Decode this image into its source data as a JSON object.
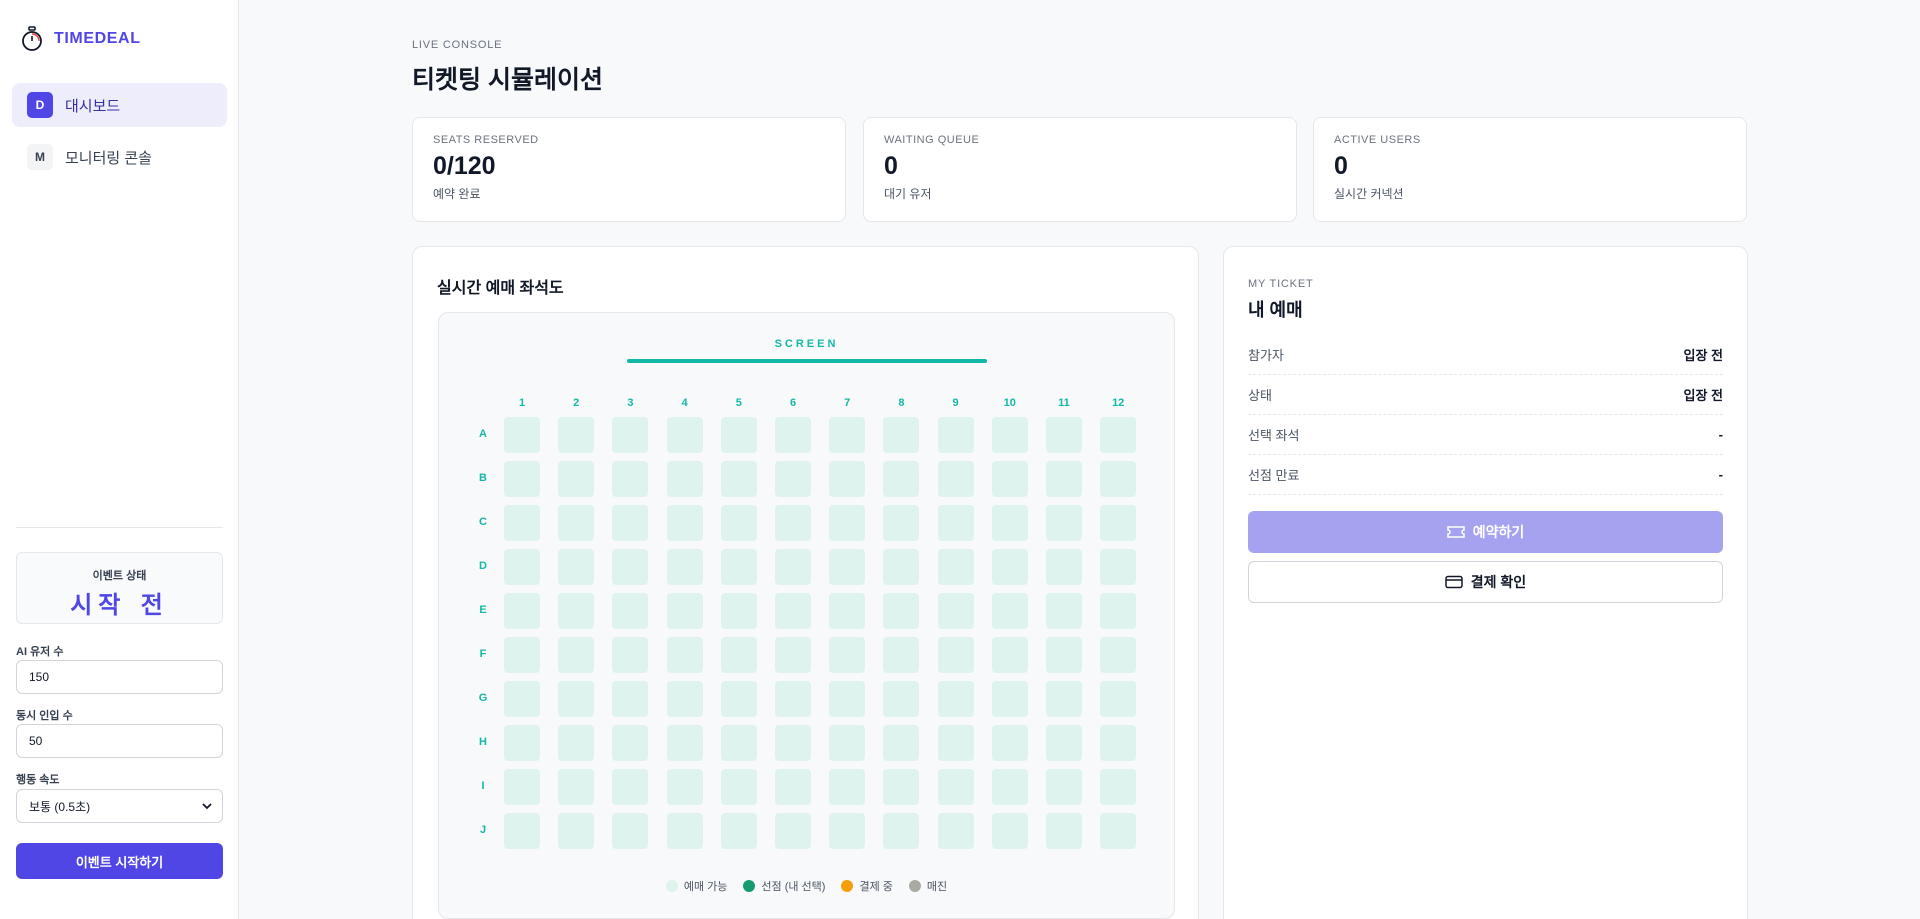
{
  "brand": {
    "name": "TIMEDEAL"
  },
  "nav": {
    "items": [
      {
        "badge": "D",
        "label": "대시보드"
      },
      {
        "badge": "M",
        "label": "모니터링 콘솔"
      }
    ]
  },
  "event": {
    "status_label": "이벤트 상태",
    "status_value": "시작 전"
  },
  "controls": {
    "ai_users_label": "AI 유저 수",
    "ai_users_value": "150",
    "concurrent_label": "동시 인입 수",
    "concurrent_value": "50",
    "speed_label": "행동 속도",
    "speed_value": "보통 (0.5초)",
    "start_button": "이벤트 시작하기"
  },
  "header": {
    "eyebrow": "LIVE CONSOLE",
    "title": "티켓팅 시뮬레이션"
  },
  "stats": [
    {
      "label": "SEATS RESERVED",
      "value": "0/120",
      "sub": "예약 완료"
    },
    {
      "label": "WAITING QUEUE",
      "value": "0",
      "sub": "대기 유저"
    },
    {
      "label": "ACTIVE USERS",
      "value": "0",
      "sub": "실시간 커넥션"
    }
  ],
  "seatmap": {
    "title": "실시간 예매 좌석도",
    "screen_label": "SCREEN",
    "columns": [
      "1",
      "2",
      "3",
      "4",
      "5",
      "6",
      "7",
      "8",
      "9",
      "10",
      "11",
      "12"
    ],
    "rows": [
      "A",
      "B",
      "C",
      "D",
      "E",
      "F",
      "G",
      "H",
      "I",
      "J"
    ],
    "seat_state": "available",
    "legend": [
      {
        "label": "예매 가능",
        "color": "#dff3ee"
      },
      {
        "label": "선점 (내 선택)",
        "color": "#149b72"
      },
      {
        "label": "결제 중",
        "color": "#f59e0b"
      },
      {
        "label": "매진",
        "color": "#a8aaa3"
      }
    ],
    "colors": {
      "accent": "#14b8a6",
      "seat_available": "#dff3ee"
    }
  },
  "ticket": {
    "eyebrow": "MY TICKET",
    "title": "내 예매",
    "rows": [
      {
        "key": "참가자",
        "value": "입장 전"
      },
      {
        "key": "상태",
        "value": "입장 전"
      },
      {
        "key": "선택 좌석",
        "value": "-"
      },
      {
        "key": "선점 만료",
        "value": "-"
      }
    ],
    "reserve_button": "예약하기",
    "pay_button": "결제 확인"
  },
  "colors": {
    "primary": "#4f46e5",
    "primary_disabled": "#a5a3f0"
  }
}
